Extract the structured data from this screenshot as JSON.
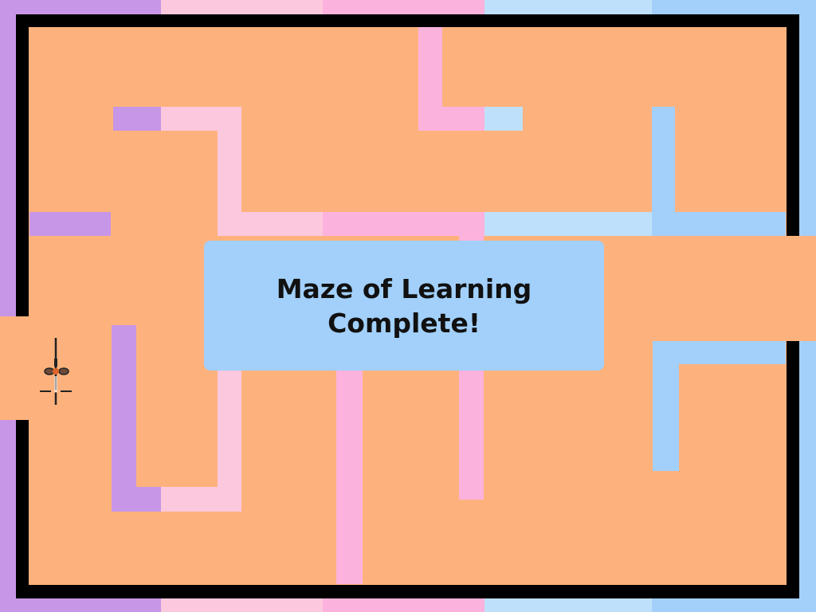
{
  "game": {
    "title": "Maze of Learning",
    "banner": {
      "line1": "Maze of Learning",
      "line2": "Complete!"
    },
    "player": {
      "name": "bug-robot",
      "icon": "beetle-icon"
    }
  },
  "colors": {
    "purple": "#c896e6",
    "light_pink": "#fcc8de",
    "pink": "#fbb2dc",
    "light_blue": "#bfe0fb",
    "blue": "#a2d0fa",
    "floor": "#fdb27d",
    "border": "#000000",
    "banner": "#a2d0fa"
  }
}
